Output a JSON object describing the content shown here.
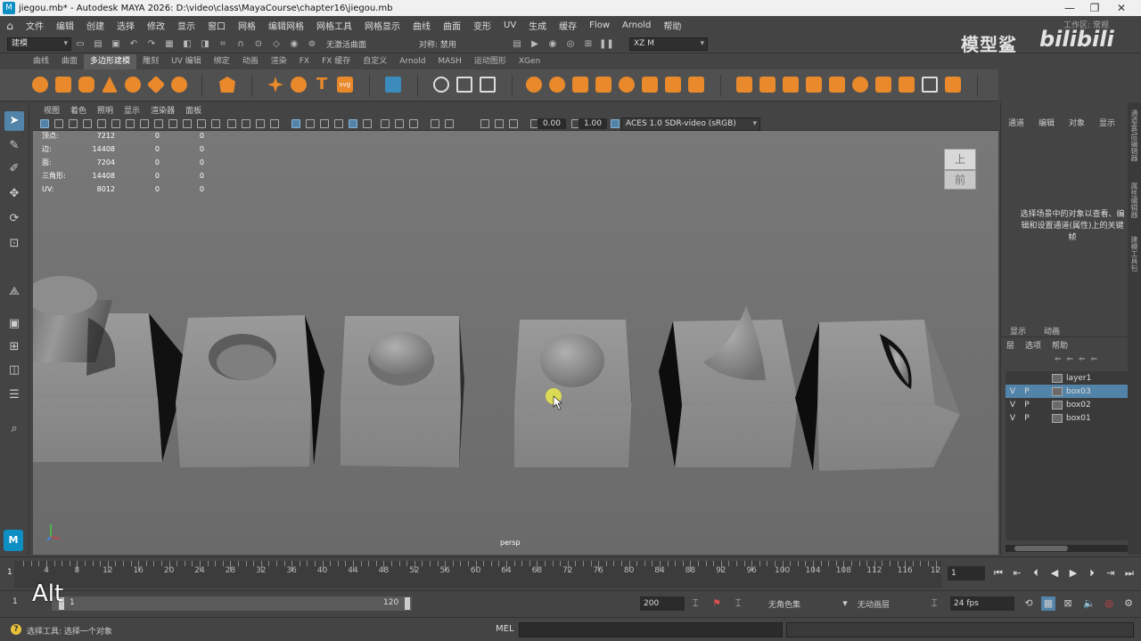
{
  "window": {
    "title": "jiegou.mb* - Autodesk MAYA 2026: D:\\video\\class\\MayaCourse\\chapter16\\jiegou.mb",
    "minimize": "—",
    "restore": "❐",
    "close": "✕"
  },
  "menubar": {
    "items": [
      "文件",
      "编辑",
      "创建",
      "选择",
      "修改",
      "显示",
      "窗口",
      "网格",
      "编辑网格",
      "网格工具",
      "网格显示",
      "曲线",
      "曲面",
      "变形",
      "UV",
      "生成",
      "缓存",
      "Flow",
      "Arnold",
      "帮助"
    ],
    "workspace_label": "工作区: 常规"
  },
  "statusline": {
    "mode": "建模",
    "live_surface": "无激活曲面",
    "symmetry": "对称: 禁用",
    "user": "XZ M"
  },
  "watermark": {
    "text1": "模型鲨",
    "text2": "bilibili"
  },
  "shelf": {
    "tabs": [
      "曲线",
      "曲面",
      "多边形建模",
      "雕刻",
      "UV 编辑",
      "绑定",
      "动画",
      "渲染",
      "FX",
      "FX 缓存",
      "自定义",
      "Arnold",
      "MASH",
      "运动图形",
      "XGen"
    ],
    "active_tab": "多边形建模"
  },
  "panel": {
    "menus": [
      "视图",
      "着色",
      "照明",
      "显示",
      "渲染器",
      "面板"
    ],
    "exposure": "0.00",
    "gamma": "1.00",
    "colorspace": "ACES 1.0 SDR-video (sRGB)"
  },
  "hud": {
    "rows": [
      {
        "label": "顶点:",
        "v1": "7212",
        "v2": "0",
        "v3": "0"
      },
      {
        "label": "边:",
        "v1": "14408",
        "v2": "0",
        "v3": "0"
      },
      {
        "label": "面:",
        "v1": "7204",
        "v2": "0",
        "v3": "0"
      },
      {
        "label": "三角形:",
        "v1": "14408",
        "v2": "0",
        "v3": "0"
      },
      {
        "label": "UV:",
        "v1": "8012",
        "v2": "0",
        "v3": "0"
      }
    ]
  },
  "viewcube": {
    "top": "上",
    "front": "前"
  },
  "viewport": {
    "camera": "persp"
  },
  "channelbox": {
    "menus": [
      "通道",
      "编辑",
      "对象",
      "显示"
    ],
    "hint": "选择场景中的对象以查看、编辑和设置通道(属性)上的关键帧"
  },
  "layers": {
    "tabs": [
      "显示",
      "动画"
    ],
    "menus": [
      "层",
      "选项",
      "帮助"
    ],
    "list": [
      {
        "v": "",
        "p": "",
        "name": "layer1",
        "selected": false
      },
      {
        "v": "V",
        "p": "P",
        "name": "box03",
        "selected": true
      },
      {
        "v": "V",
        "p": "P",
        "name": "box02",
        "selected": false
      },
      {
        "v": "V",
        "p": "P",
        "name": "box01",
        "selected": false
      }
    ]
  },
  "right_strip": {
    "tabs": [
      "通道盒/层编辑器",
      "属性编辑器",
      "建模工具包"
    ]
  },
  "timeline": {
    "labels": [
      "4",
      "8",
      "12",
      "16",
      "20",
      "24",
      "28",
      "32",
      "36",
      "40",
      "44",
      "48",
      "52",
      "56",
      "60",
      "64",
      "68",
      "72",
      "76",
      "80",
      "84",
      "88",
      "92",
      "96",
      "100",
      "104",
      "108",
      "112",
      "116",
      "12"
    ],
    "current_frame_marker": "1",
    "current_frame": "1"
  },
  "range": {
    "start": "1",
    "inner_start": "1",
    "inner_end": "120",
    "end": "200",
    "char_set": "无角色集",
    "anim_layer": "无动画层",
    "fps": "24 fps"
  },
  "helpline": {
    "text": "选择工具: 选择一个对象",
    "mel": "MEL"
  },
  "overlay": {
    "key": "Alt"
  }
}
